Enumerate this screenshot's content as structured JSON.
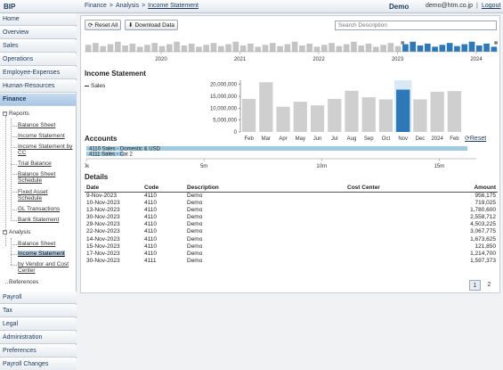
{
  "app": {
    "title": "BIP"
  },
  "breadcrumb": {
    "items": [
      "Finance",
      "Analysis",
      "Income Statement"
    ]
  },
  "user": {
    "name": "Demo",
    "email": "demo@htm.co.jp",
    "separator": "|",
    "logout": "Logout"
  },
  "sidebar": {
    "top_items": [
      "Home",
      "Overview",
      "Sales",
      "Operations",
      "Employee-Expenses",
      "Human-Resources",
      "Finance"
    ],
    "active": "Finance",
    "reports": {
      "label": "Reports",
      "items": [
        "Balance Sheet",
        "Income Statement",
        "Income Statement by CC",
        "Trial Balance",
        "Balance Sheet Schedule",
        "Fixed Asset Schedule",
        "GL Transactions",
        "Bank Statement"
      ]
    },
    "analysis": {
      "label": "Analysis",
      "items": [
        "Balance Sheet",
        "Income Statement",
        "by Vendor and Cost Center"
      ],
      "selected": "Income Statement"
    },
    "references": "References",
    "bottom_items": [
      "Payroll",
      "Tax",
      "Legal",
      "Administration",
      "Preferences",
      "Payroll Changes"
    ]
  },
  "toolbar": {
    "reset_label": "Reset All",
    "download_label": "Download Data",
    "search_placeholder": "Search Description"
  },
  "timeline": {
    "years": [
      "2020",
      "2021",
      "2022",
      "2023",
      "2024"
    ],
    "bar_count": 56,
    "selected_start_fraction": 0.77,
    "selected_end_fraction": 1.0,
    "colors": {
      "unselected": "#c4c4c4",
      "selected": "#2e78b8"
    }
  },
  "income_statement": {
    "title": "Income Statement",
    "legend": "Sales",
    "chart_data": {
      "type": "bar",
      "categories": [
        "Feb",
        "Mar",
        "Apr",
        "May",
        "Jun",
        "Jul",
        "Aug",
        "Sep",
        "Oct",
        "Nov",
        "Dec",
        "2024",
        "Feb"
      ],
      "values": [
        13900000,
        20900000,
        10600000,
        12700000,
        11200000,
        13900000,
        17300000,
        14600000,
        13700000,
        17800000,
        13700000,
        16900000,
        17200000
      ],
      "highlight_index": 9,
      "ylim": [
        0,
        20000000
      ],
      "yticks": [
        "0",
        "5,000,000",
        "10,000,000",
        "15,000,000",
        "20,000,000"
      ],
      "grid": false,
      "colors": {
        "bar": "#cfcfcf",
        "highlight": "#2e78b8",
        "highlight_band": "#d8e8f5"
      }
    }
  },
  "accounts": {
    "title": "Accounts",
    "reset": "Reset",
    "rows": [
      {
        "label": "4110 Sales - Domestic & USD",
        "value": 16200000
      },
      {
        "label": "4111 Sales - Cat 2",
        "value": 1600000
      }
    ],
    "axis_ticks": [
      {
        "label": "0k",
        "value": 0
      },
      {
        "label": "5m",
        "value": 5000000
      },
      {
        "label": "10m",
        "value": 10000000
      },
      {
        "label": "15m",
        "value": 15000000
      }
    ],
    "xlim": [
      0,
      16500000
    ],
    "colors": {
      "bar": "#9ecbe2"
    }
  },
  "details": {
    "title": "Details",
    "columns": [
      "Date",
      "Code",
      "Description",
      "Cost Center",
      "Amount"
    ],
    "rows": [
      [
        "9-Nov-2023",
        "4110",
        "Demo",
        "",
        "956,175"
      ],
      [
        "10-Nov-2023",
        "4110",
        "Demo",
        "",
        "719,025"
      ],
      [
        "13-Nov-2023",
        "4110",
        "Demo",
        "",
        "1,780,600"
      ],
      [
        "30-Nov-2023",
        "4110",
        "Demo",
        "",
        "2,558,712"
      ],
      [
        "29-Nov-2023",
        "4110",
        "Demo",
        "",
        "4,503,225"
      ],
      [
        "22-Nov-2023",
        "4110",
        "Demo",
        "",
        "3,067,775"
      ],
      [
        "14-Nov-2023",
        "4110",
        "Demo",
        "",
        "1,673,625"
      ],
      [
        "15-Nov-2023",
        "4110",
        "Demo",
        "",
        "121,850"
      ],
      [
        "17-Nov-2023",
        "4110",
        "Demo",
        "",
        "1,214,700"
      ],
      [
        "30-Nov-2023",
        "4111",
        "Demo",
        "",
        "1,597,373"
      ]
    ],
    "pages": [
      "1",
      "2"
    ],
    "current_page": "1"
  }
}
